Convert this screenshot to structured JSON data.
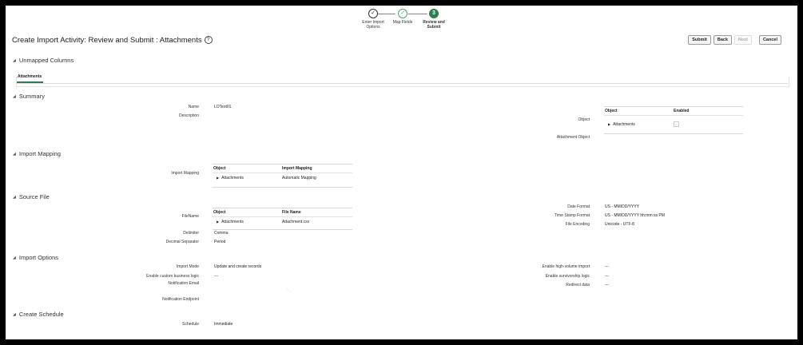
{
  "train": {
    "steps": [
      {
        "label_1": "Enter Import",
        "label_2": "Options",
        "mark": "✓"
      },
      {
        "label_1": "Map Fields",
        "label_2": "",
        "mark": "✓"
      },
      {
        "label_1": "Review and",
        "label_2": "Submit",
        "mark": "3"
      }
    ]
  },
  "page": {
    "title": "Create Import Activity: Review and Submit : Attachments",
    "help_icon": "?"
  },
  "toolbar": {
    "submit": "Submit",
    "back": "Back",
    "next": "Next",
    "cancel": "Cancel"
  },
  "unmapped": {
    "title": "Unmapped Columns",
    "tab": "Attachments"
  },
  "summary": {
    "title": "Summary",
    "name_label": "Name",
    "name_value": "LOTest01",
    "description_label": "Description",
    "object_label": "Object",
    "attachment_object_label": "Attachment Object",
    "table": {
      "col_object": "Object",
      "col_enabled": "Enabled",
      "row_object": "Attachments"
    }
  },
  "import_mapping": {
    "title": "Import Mapping",
    "label": "Import Mapping",
    "table": {
      "col_object": "Object",
      "col_mapping": "Import Mapping",
      "row_object": "Attachments",
      "row_mapping": "Automatic Mapping"
    }
  },
  "source_file": {
    "title": "Source File",
    "filename_label": "FileName",
    "table": {
      "col_object": "Object",
      "col_file": "File Name",
      "row_object": "Attachments",
      "row_file": "Attachment.csv"
    },
    "delimiter_label": "Delimiter",
    "delimiter_value": "Comma",
    "decimal_label": "Decimal Separator",
    "decimal_value": "Period",
    "date_format_label": "Date Format",
    "date_format_value": "US - MM/DD/YYYY",
    "timestamp_label": "Time Stamp Format",
    "timestamp_value": "US - MM/DD/YYYY hh:mm:ss PM",
    "encoding_label": "File Encoding",
    "encoding_value": "Unicode - UTF-8"
  },
  "import_options": {
    "title": "Import Options",
    "mode_label": "Import Mode",
    "mode_value": "Update and create records",
    "custom_logic_label": "Enable custom business logic",
    "custom_logic_value": "---",
    "notification_email_label": "Notification Email",
    "notification_endpoint_label": "Notification Endpoint",
    "high_volume_label": "Enable high-volume import",
    "high_volume_value": "---",
    "survivorship_label": "Enable survivorship logic",
    "survivorship_value": "---",
    "redirect_label": "Redirect data",
    "redirect_value": "---"
  },
  "schedule": {
    "title": "Create Schedule",
    "label": "Schedule",
    "value": "Immediate"
  },
  "colors": {
    "accent": "#2f7d51",
    "train_done": "#5e9c76",
    "border": "#000000"
  }
}
